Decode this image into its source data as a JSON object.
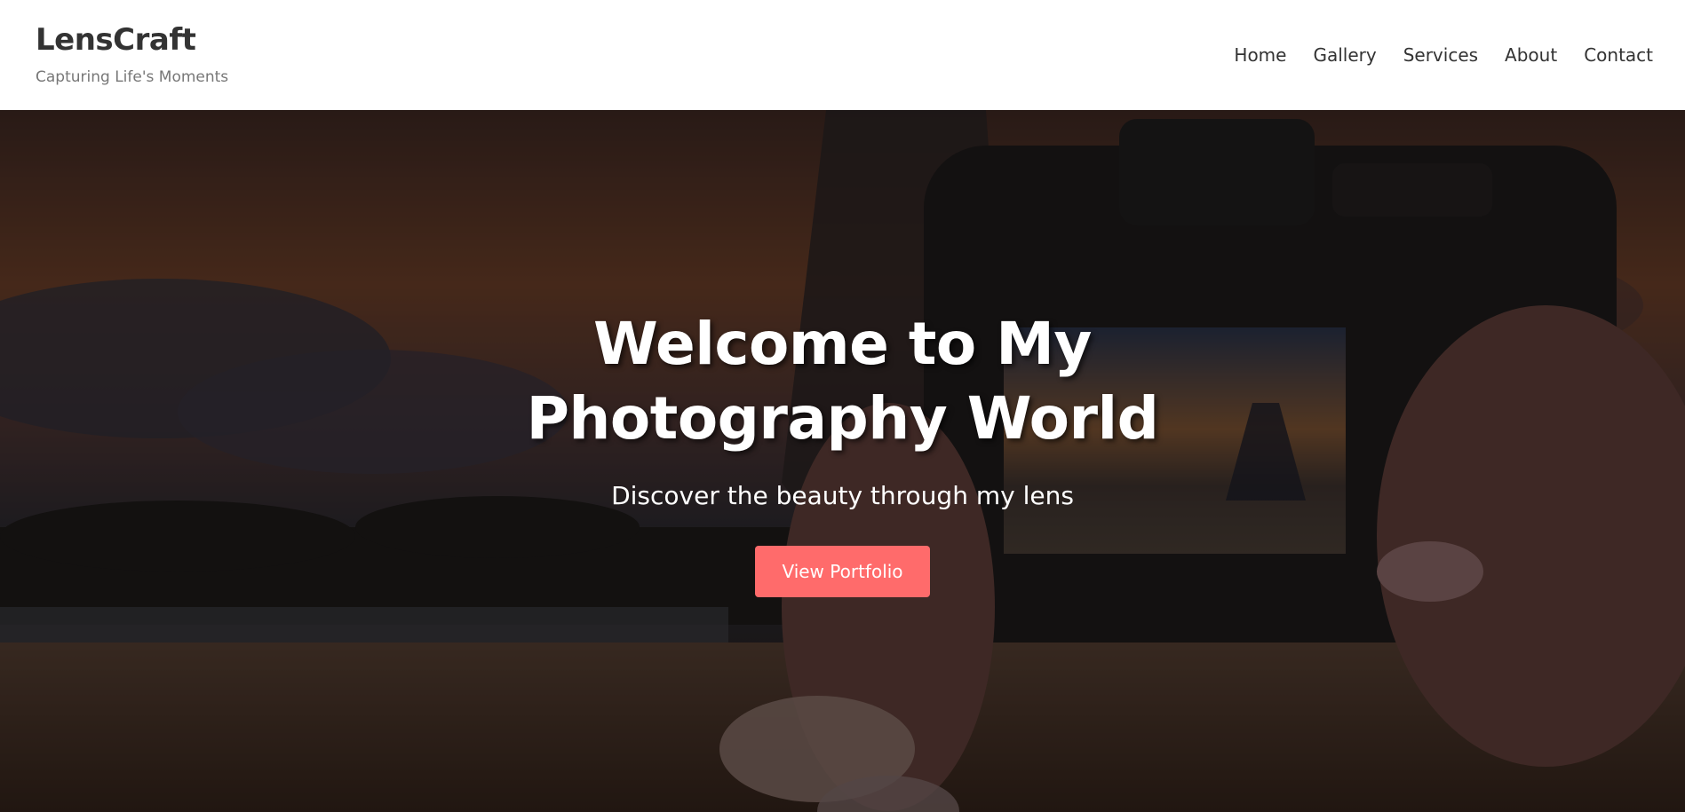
{
  "header": {
    "brand_name": "LensCraft",
    "tagline": "Capturing Life's Moments",
    "nav": [
      {
        "label": "Home"
      },
      {
        "label": "Gallery"
      },
      {
        "label": "Services"
      },
      {
        "label": "About"
      },
      {
        "label": "Contact"
      }
    ]
  },
  "hero": {
    "title": "Welcome to My Photography World",
    "subtitle": "Discover the beauty through my lens",
    "cta_label": "View Portfolio",
    "background_image": "hands-holding-canon-camera-photographing-eiffel-tower-at-sunset"
  },
  "colors": {
    "accent": "#ff6b6b",
    "header_bg": "#ffffff",
    "brand_text": "#333333",
    "tagline_text": "#777777",
    "hero_text": "#ffffff"
  }
}
